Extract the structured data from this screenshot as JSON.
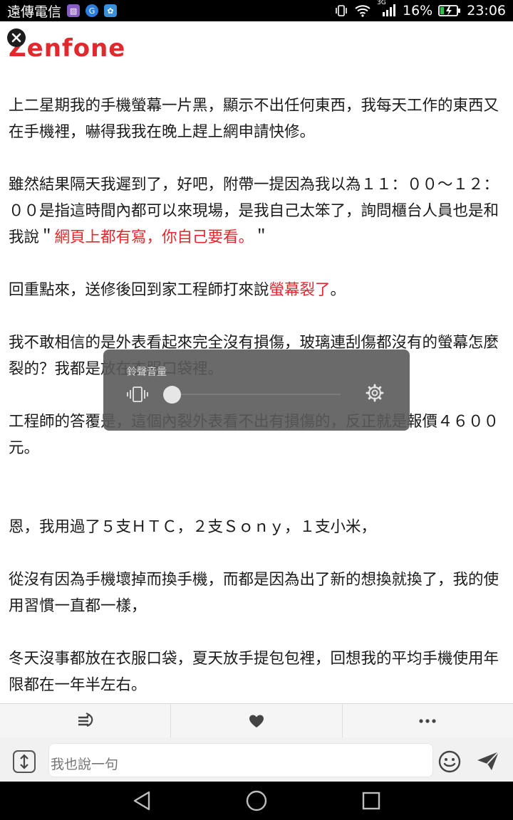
{
  "status_bar": {
    "carrier": "遠傳電信",
    "network": "3G",
    "battery": "16%",
    "time": "23:06"
  },
  "article": {
    "cut_title": "Zenfone",
    "paragraphs": [
      {
        "runs": [
          {
            "text": "上二星期我的手機螢幕一片黑，顯示不出任何東西，我每天工作的東西又在手機裡，嚇得我我在晚上趕上網申請快修。",
            "red": false
          }
        ]
      },
      {
        "runs": [
          {
            "text": "雖然結果隔天我遲到了，好吧，附帶一提因為我以為１１：００～１２：００是指這時間內都可以來現場，是我自己太笨了，詢問櫃台人員也是和我說＂",
            "red": false
          },
          {
            "text": "網頁上都有寫，你自己要看。",
            "red": true
          },
          {
            "text": "＂",
            "red": false
          }
        ]
      },
      {
        "runs": [
          {
            "text": "回重點來，送修後回到家工程師打來說",
            "red": false
          },
          {
            "text": "螢幕裂了",
            "red": true
          },
          {
            "text": "。",
            "red": false
          }
        ]
      },
      {
        "runs": [
          {
            "text": "我不敢相信的是外表看起來完全沒有損傷，玻璃連刮傷都沒有的螢幕怎麼裂的？我都是放在衣服口袋裡。",
            "red": false
          }
        ]
      },
      {
        "runs": [
          {
            "text": "工程師的答覆是，這個內裂外表看不出有損傷的，反正就是報價４６００元。",
            "red": false
          }
        ],
        "extra_gap": true
      },
      {
        "runs": [
          {
            "text": "恩，我用過了５支ＨＴＣ，２支Ｓｏｎｙ，１支小米，",
            "red": false
          }
        ]
      },
      {
        "runs": [
          {
            "text": "從沒有因為手機壞掉而換手機，而都是因為出了新的想換就換了，我的使用習慣一直都一樣，",
            "red": false
          }
        ]
      },
      {
        "runs": [
          {
            "text": "冬天沒事都放在衣服口袋，夏天放手提包包裡，回想我的平均手機使用年限都在一年半左右。",
            "red": false
          }
        ]
      }
    ]
  },
  "volume_panel": {
    "label": "鈴聲音量",
    "level": 0,
    "mode_icon": "vibrate-icon",
    "settings_icon": "gear-icon"
  },
  "action_bar": {
    "icons": [
      "rewind-list-icon",
      "heart-icon",
      "more-dots-icon"
    ]
  },
  "comment_bar": {
    "placeholder": "我也說一句",
    "icons": [
      "expand-icon",
      "emoji-icon",
      "send-icon"
    ]
  },
  "nav_bar": {
    "icons": [
      "back-icon",
      "home-icon",
      "recents-icon"
    ]
  },
  "colors": {
    "accent_red": "#e0282d",
    "overlay": "#5a5a5a"
  }
}
